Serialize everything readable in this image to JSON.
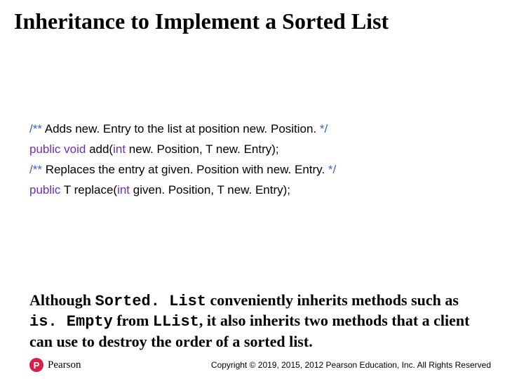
{
  "title": "Inheritance to Implement  a Sorted List",
  "code": {
    "l1": {
      "open": "/**",
      "text": " Adds new. Entry to the list at position new. Position. ",
      "close": "*/"
    },
    "l2": {
      "kw1": "public",
      "kw2": "void",
      "name": " add(",
      "kw3": "int",
      "rest": " new. Position, T new. Entry);"
    },
    "l3": {
      "open": "/**",
      "text": " Replaces the entry at given. Position with new. Entry. ",
      "close": "*/"
    },
    "l4": {
      "kw1": "public",
      "ret": " T replace(",
      "kw3": "int",
      "rest": " given. Position, T new. Entry);"
    }
  },
  "body": {
    "t1": "Although ",
    "m1": "Sorted. List",
    "t2": " conveniently inherits methods such as ",
    "m2": "is. Empty",
    "t3": " from ",
    "m3": "LList",
    "t4": ", it also inherits two methods that a client can use to destroy the order of a sorted list."
  },
  "footer": {
    "logo_letter": "P",
    "logo_text": "Pearson",
    "copyright": "Copyright © 2019, 2015, 2012 Pearson Education, Inc. All Rights Reserved"
  }
}
